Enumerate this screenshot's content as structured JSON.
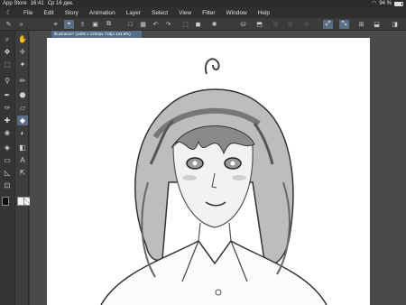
{
  "status_bar": {
    "carrier": "App Store",
    "time": "16:41",
    "date": "Ср 16 дек.",
    "battery": "94 %"
  },
  "menu": {
    "logo_icon": "clip-studio-icon",
    "items": [
      "File",
      "Edit",
      "Story",
      "Animation",
      "Layer",
      "Select",
      "View",
      "Filter",
      "Window",
      "Help"
    ]
  },
  "document": {
    "tab_title": "Illustration* (1600 x 1200px 72dpi 124.6%)"
  },
  "colors": {
    "accent": "#5a6e86",
    "canvas": "#ffffff",
    "panel": "#3b3b3b"
  }
}
